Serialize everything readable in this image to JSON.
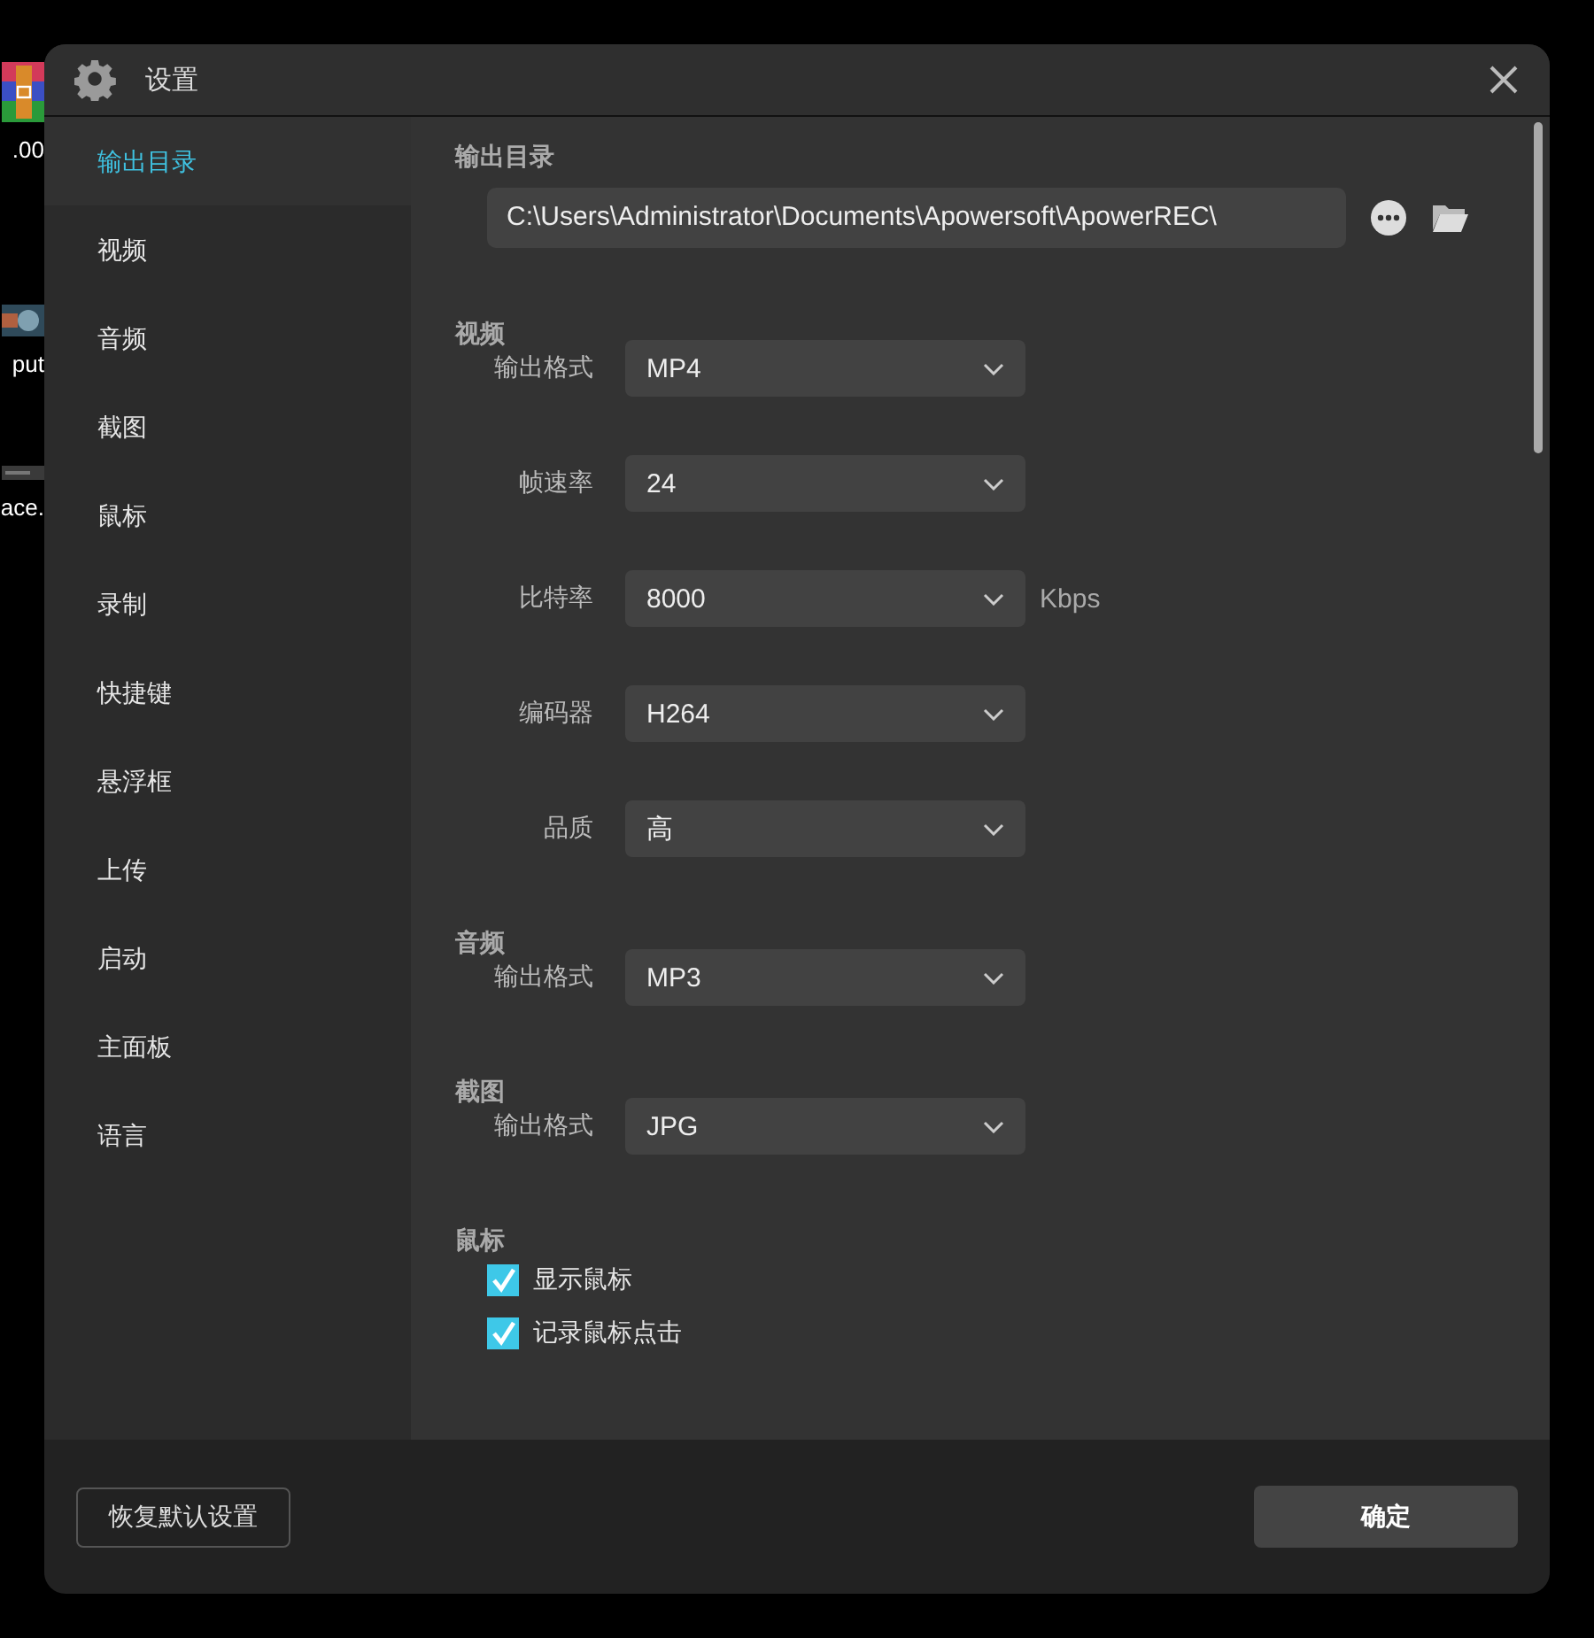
{
  "desktop": {
    "items": [
      {
        "kind": "archive",
        "label": ".00"
      },
      {
        "kind": "thumbnail",
        "label": "put"
      },
      {
        "kind": "strip",
        "label": "ace."
      }
    ]
  },
  "window": {
    "title": "设置"
  },
  "sidebar": {
    "items": [
      {
        "label": "输出目录",
        "selected": true
      },
      {
        "label": "视频",
        "selected": false
      },
      {
        "label": "音频",
        "selected": false
      },
      {
        "label": "截图",
        "selected": false
      },
      {
        "label": "鼠标",
        "selected": false
      },
      {
        "label": "录制",
        "selected": false
      },
      {
        "label": "快捷键",
        "selected": false
      },
      {
        "label": "悬浮框",
        "selected": false
      },
      {
        "label": "上传",
        "selected": false
      },
      {
        "label": "启动",
        "selected": false
      },
      {
        "label": "主面板",
        "selected": false
      },
      {
        "label": "语言",
        "selected": false
      }
    ]
  },
  "output_directory": {
    "heading": "输出目录",
    "path": "C:\\Users\\Administrator\\Documents\\Apowersoft\\ApowerREC\\"
  },
  "sections": [
    {
      "heading": "视频",
      "fields": [
        {
          "label": "输出格式",
          "value": "MP4"
        },
        {
          "label": "帧速率",
          "value": "24"
        },
        {
          "label": "比特率",
          "value": "8000",
          "unit": "Kbps"
        },
        {
          "label": "编码器",
          "value": "H264"
        },
        {
          "label": "品质",
          "value": "高"
        }
      ]
    },
    {
      "heading": "音频",
      "fields": [
        {
          "label": "输出格式",
          "value": "MP3"
        }
      ]
    },
    {
      "heading": "截图",
      "fields": [
        {
          "label": "输出格式",
          "value": "JPG"
        }
      ]
    }
  ],
  "mouse": {
    "heading": "鼠标",
    "options": [
      {
        "label": "显示鼠标",
        "checked": true
      },
      {
        "label": "记录鼠标点击",
        "checked": true
      }
    ]
  },
  "footer": {
    "reset_button": "恢复默认设置",
    "ok_button": "确定"
  }
}
